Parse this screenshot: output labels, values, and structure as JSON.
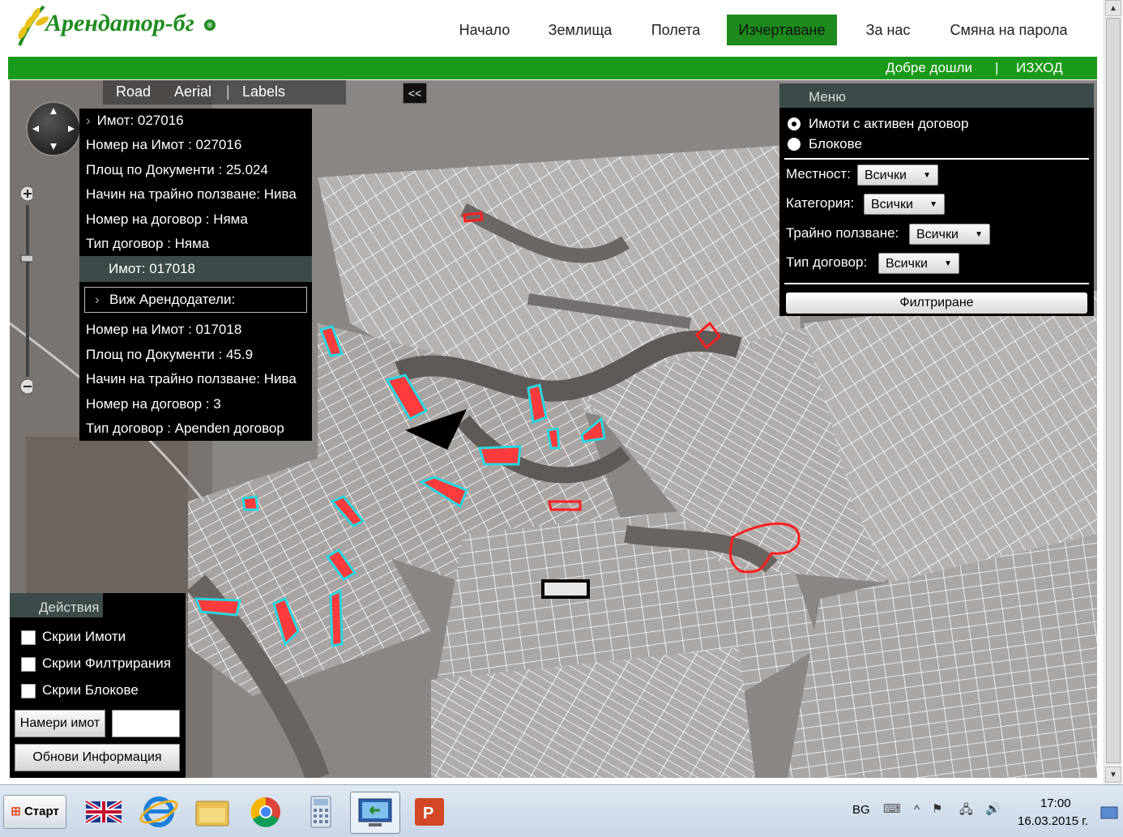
{
  "header": {
    "logo_text": "Арендатор-бг",
    "nav": [
      "Начало",
      "Землища",
      "Полета",
      "Изчертаване",
      "За нас",
      "Смяна на парола"
    ],
    "active_nav": "Изчертаване",
    "welcome": "Добре дошли",
    "separator": "|",
    "logout": "ИЗХОД"
  },
  "map": {
    "tabs": [
      "Road",
      "Aerial",
      "Labels"
    ],
    "separator": "|",
    "collapse_label": "<<"
  },
  "info_panel": {
    "property1_header": "Имот: 027016",
    "property1_rows": [
      "Номер на Имот : 027016",
      "Площ по Документи : 25.024",
      "Начин на трайно ползване: Нива",
      "Номер на договор :  Няма",
      "Тип договор :  Няма"
    ],
    "property2_header": "Имот: 017018",
    "view_landlords": "Виж Арендодатели:",
    "property2_rows": [
      "Номер на Имот : 017018",
      "Площ по Документи : 45.9",
      "Начин на трайно ползване: Нива",
      "Номер на договор : 3",
      "Тип договор : Арenden договор"
    ]
  },
  "menu": {
    "title": "Меню",
    "radio_options": [
      "Имоти с активен договор",
      "Блокове"
    ],
    "selected_radio": 0,
    "filters": [
      {
        "label": "Местност:",
        "value": "Всички"
      },
      {
        "label": "Категория:",
        "value": "Всички"
      },
      {
        "label": "Трайно ползване:",
        "value": "Всички"
      },
      {
        "label": "Тип договор:",
        "value": "Всички"
      }
    ],
    "filter_button": "Филтриране"
  },
  "actions": {
    "title": "Действия",
    "checkboxes": [
      "Скрии Имоти",
      "Скрии Филтрирания",
      "Скрии Блокове"
    ],
    "find_button": "Намери имот",
    "find_value": "",
    "refresh_button": "Обнови Информация"
  },
  "taskbar": {
    "start_label": "Старт",
    "apps": [
      "uk-flag-icon",
      "internet-explorer-icon",
      "file-explorer-icon",
      "chrome-icon",
      "calculator-icon",
      "remote-desktop-icon",
      "powerpoint-icon"
    ],
    "language": "BG",
    "time": "17:00",
    "date": "16.03.2015 г."
  },
  "colors": {
    "brand_green": "#1a9a1a",
    "highlight_red": "#ff3b3b",
    "parcel_outline_cyan": "#29d6e0"
  }
}
